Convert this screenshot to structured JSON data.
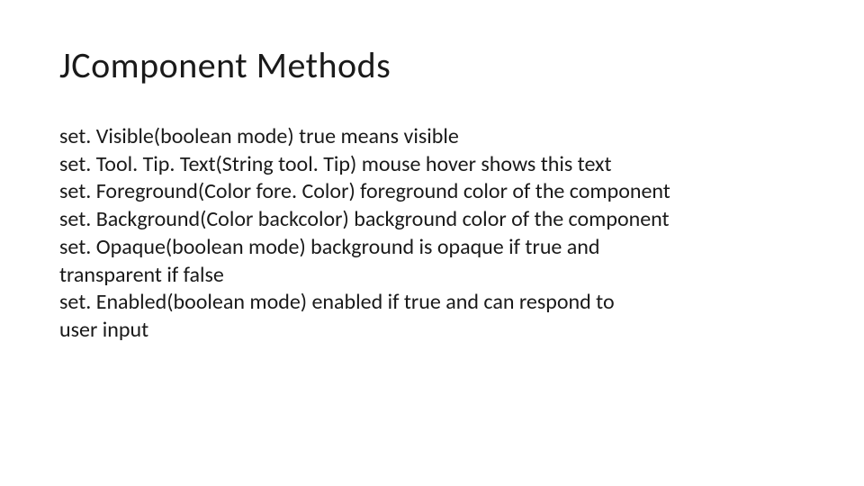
{
  "title": "JComponent Methods",
  "lines": {
    "l0": "set. Visible(boolean mode) true means visible",
    "l1": "set. Tool. Tip. Text(String tool. Tip) mouse hover shows this text",
    "l2": "set. Foreground(Color fore. Color) foreground color of the component",
    "l3": "set. Background(Color backcolor) background color of the component",
    "l4": "set. Opaque(boolean mode) background is opaque if true and",
    "l5": "transparent if false",
    "l6": "set. Enabled(boolean mode) enabled if true and can respond to",
    "l7": "user input"
  }
}
